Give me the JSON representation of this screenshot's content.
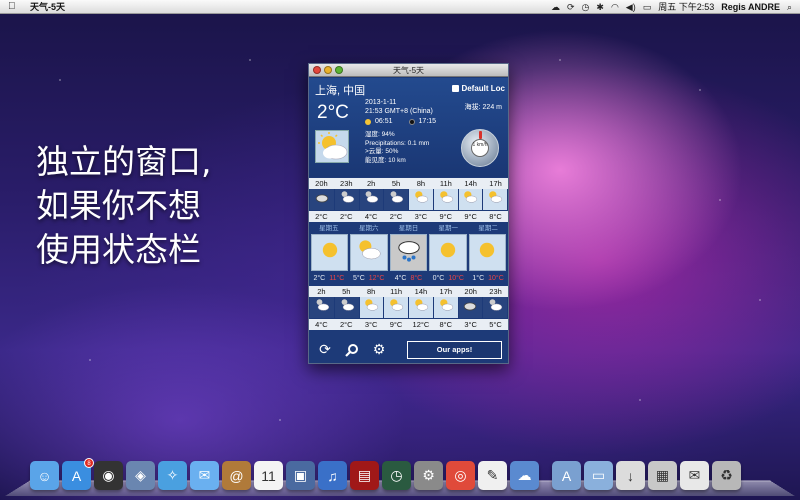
{
  "menubar": {
    "app_name": "天气-5天",
    "clock": "周五 下午2:53",
    "user": "Regis ANDRE"
  },
  "promo": {
    "line1": "独立的窗口,",
    "line2": "如果你不想",
    "line3": "使用状态栏"
  },
  "window": {
    "title": "天气-5天",
    "city": "上海, 中国",
    "default_loc": "Default Loc",
    "current_temp": "2°C",
    "date": "2013-1-11",
    "time": "21:53 GMT+8 (China)",
    "altitude": "海拔: 224 m",
    "sunrise": "06:51",
    "sunset": "17:15",
    "humidity": "湿度: 94%",
    "precipitation": "Precipitations: 0.1 mm",
    "cloud": ">云量: 50%",
    "visibility": "能见度: 10 km",
    "wind": "1 km/h",
    "hourly1": {
      "times": [
        "20h",
        "23h",
        "2h",
        "5h",
        "8h",
        "11h",
        "14h",
        "17h"
      ],
      "icons": [
        "cloud-night-icon",
        "partly-cloudy-night-icon",
        "partly-cloudy-night-icon",
        "partly-cloudy-night-icon",
        "partly-cloudy-icon",
        "partly-cloudy-icon",
        "partly-cloudy-icon",
        "partly-cloudy-icon"
      ],
      "temps": [
        "2°C",
        "2°C",
        "4°C",
        "2°C",
        "3°C",
        "9°C",
        "9°C",
        "8°C"
      ]
    },
    "daily": {
      "days": [
        "星期五",
        "星期六",
        "星期日",
        "星期一",
        "星期二"
      ],
      "icons": [
        "sun-icon",
        "partly-cloudy-icon",
        "rain-cloud-icon",
        "sun-icon",
        "sun-icon"
      ],
      "highs": [
        "2°C",
        "5°C",
        "4°C",
        "0°C",
        "1°C"
      ],
      "lows": [
        "11°C",
        "12°C",
        "8°C",
        "10°C",
        "10°C"
      ]
    },
    "hourly2": {
      "times": [
        "2h",
        "5h",
        "8h",
        "11h",
        "14h",
        "17h",
        "20h",
        "23h"
      ],
      "icons": [
        "partly-cloudy-night-icon",
        "partly-cloudy-night-icon",
        "partly-cloudy-icon",
        "partly-cloudy-icon",
        "partly-cloudy-icon",
        "partly-cloudy-icon",
        "cloud-night-icon",
        "partly-cloudy-night-icon"
      ],
      "temps": [
        "4°C",
        "2°C",
        "3°C",
        "9°C",
        "12°C",
        "8°C",
        "3°C",
        "5°C"
      ]
    },
    "our_apps": "Our apps!"
  },
  "dock": {
    "items": [
      "finder-icon",
      "app-store-icon",
      "dashboard-icon",
      "preview-icon",
      "safari-icon",
      "ichat-icon",
      "address-book-icon",
      "ical-icon",
      "iphoto-icon",
      "itunes-icon",
      "photo-booth-icon",
      "time-machine-icon",
      "system-preferences-icon",
      "chrome-icon",
      "textedit-icon",
      "weather-icon",
      "applications-folder-icon",
      "documents-folder-icon",
      "download-icon",
      "screenshot-icon",
      "mail-icon",
      "trash-icon"
    ],
    "badge_count": "8"
  }
}
